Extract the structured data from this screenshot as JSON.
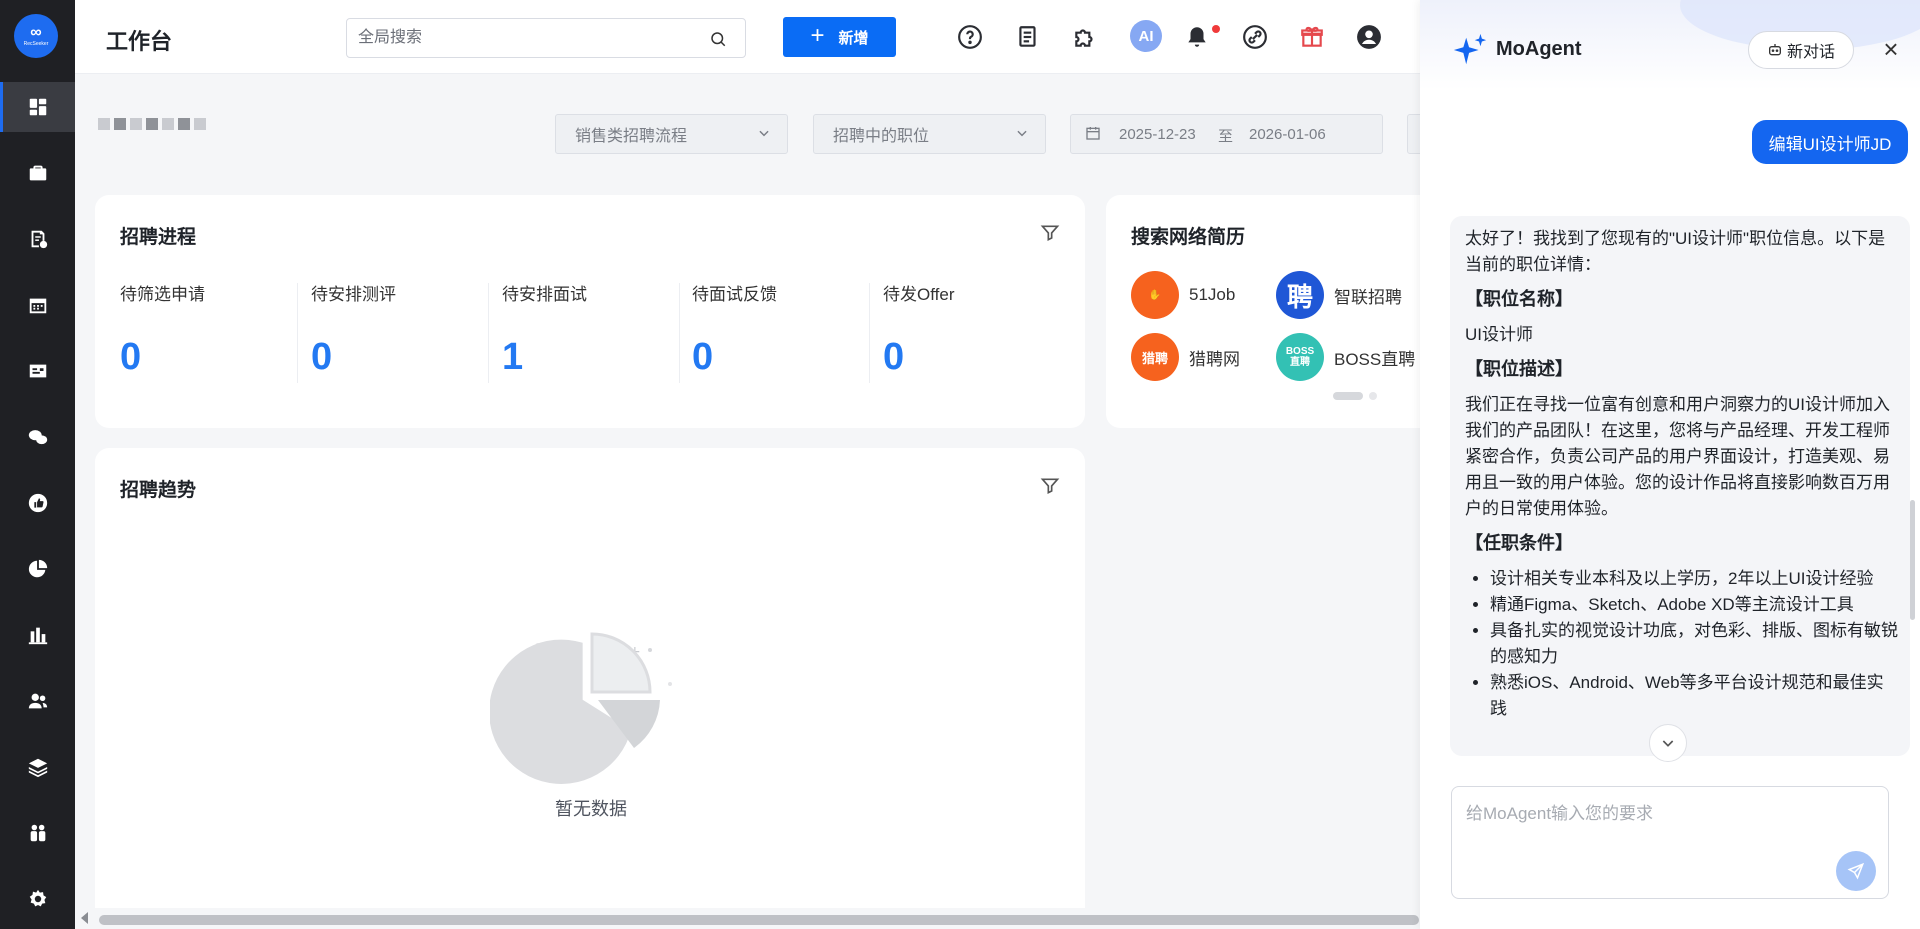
{
  "app": {
    "logo_text": "RecSeeker"
  },
  "header": {
    "title": "工作台",
    "search_placeholder": "全局搜索",
    "add_button": "新增",
    "icons": [
      "help-icon",
      "document-icon",
      "plugin-icon",
      "ai-icon",
      "bell-icon",
      "link-icon",
      "gift-icon",
      "user-icon"
    ],
    "ai_label": "AI"
  },
  "sidebar": {
    "items": [
      "dashboard-icon",
      "briefcase-icon",
      "resume-icon",
      "calendar-icon",
      "id-card-icon",
      "wechat-icon",
      "thumb-up-icon",
      "pie-chart-icon",
      "bar-chart-icon",
      "people-icon",
      "layers-icon",
      "team-icon",
      "settings-icon"
    ],
    "active_index": 0
  },
  "filters": {
    "process": "销售类招聘流程",
    "position": "招聘中的职位",
    "date_start": "2025-12-23",
    "date_sep": "至",
    "date_end": "2026-01-06"
  },
  "progress_card": {
    "title": "招聘进程",
    "stats": [
      {
        "label": "待筛选申请",
        "value": "0"
      },
      {
        "label": "待安排测评",
        "value": "0"
      },
      {
        "label": "待安排面试",
        "value": "1"
      },
      {
        "label": "待面试反馈",
        "value": "0"
      },
      {
        "label": "待发Offer",
        "value": "0"
      }
    ]
  },
  "search_card": {
    "title": "搜索网络简历",
    "sites": [
      {
        "name": "51Job",
        "badge": "51Job",
        "color": "#f6621e"
      },
      {
        "name": "智联招聘",
        "badge": "聘",
        "color": "#1f57d6"
      },
      {
        "name": "猎聘网",
        "badge": "猎聘",
        "color": "#f6621e"
      },
      {
        "name": "BOSS直聘",
        "badge": "BOSS直聘",
        "color": "#33c1b4"
      }
    ]
  },
  "trend_card": {
    "title": "招聘趋势",
    "empty_text": "暂无数据"
  },
  "agent": {
    "title": "MoAgent",
    "new_chat": "新对话",
    "user_message": "编辑UI设计师JD",
    "answer": {
      "intro": "太好了！我找到了您现有的\"UI设计师\"职位信息。以下是当前的职位详情：",
      "name_heading": "【职位名称】",
      "name_value": "UI设计师",
      "desc_heading": "【职位描述】",
      "desc_value": "我们正在寻找一位富有创意和用户洞察力的UI设计师加入我们的产品团队！在这里，您将与产品经理、开发工程师紧密合作，负责公司产品的用户界面设计，打造美观、易用且一致的用户体验。您的设计作品将直接影响数百万用户的日常使用体验。",
      "req_heading": "【任职条件】",
      "requirements": [
        "设计相关专业本科及以上学历，2年以上UI设计经验",
        "精通Figma、Sketch、Adobe XD等主流设计工具",
        "具备扎实的视觉设计功底，对色彩、排版、图标有敏锐的感知力",
        "熟悉iOS、Android、Web等多平台设计规范和最佳实践"
      ]
    },
    "input_placeholder": "给MoAgent输入您的要求"
  },
  "colors": {
    "primary": "#0a6cf5",
    "stat_value": "#2379f2",
    "sidebar_bg": "#1f2024"
  }
}
